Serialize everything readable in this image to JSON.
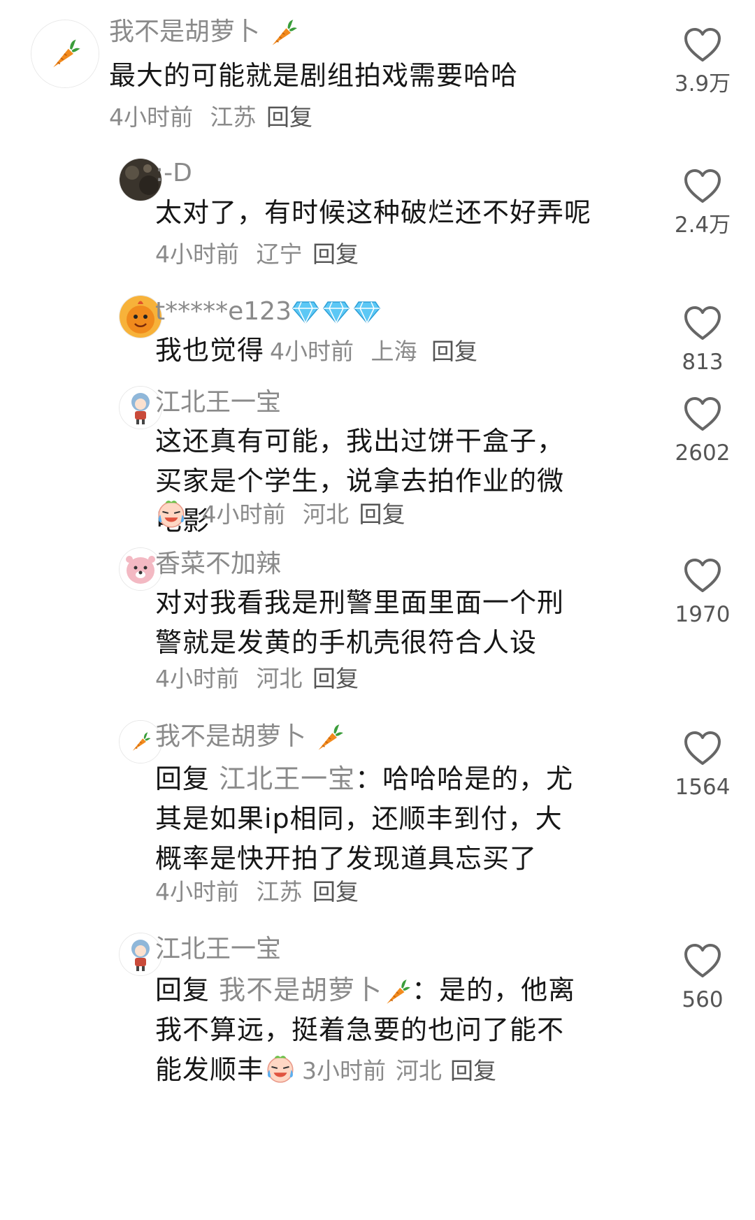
{
  "comments": [
    {
      "username": "我不是胡萝卜",
      "text": "最大的可能就是剧组拍戏需要哈哈",
      "time": "4小时前",
      "location": "江苏",
      "reply_label": "回复",
      "likes": "3.9万",
      "avatar_icon": "carrot-icon"
    },
    {
      "username": ":-D",
      "text": "太对了，有时候这种破烂还不好弄呢",
      "time": "4小时前",
      "location": "辽宁",
      "reply_label": "回复",
      "likes": "2.4万",
      "avatar_icon": "dark-photo-avatar"
    },
    {
      "username": "t*****e123",
      "text": "我也觉得",
      "time": "4小时前",
      "location": "上海",
      "reply_label": "回复",
      "likes": "813",
      "avatar_icon": "orange-cartoon-avatar",
      "badges": [
        "diamond-icon",
        "diamond-icon",
        "diamond-icon"
      ]
    },
    {
      "username": "江北王一宝",
      "text": "这还真有可能，我出过饼干盒子，买家是个学生，说拿去拍作业的微电影",
      "time": "4小时前",
      "location": "河北",
      "reply_label": "回复",
      "likes": "2602",
      "avatar_icon": "chibi-avatar",
      "emoji": "crying-laugh-emoji"
    },
    {
      "username": "香菜不加辣",
      "text": "对对我看我是刑警里面里面一个刑警就是发黄的手机壳很符合人设",
      "time": "4小时前",
      "location": "河北",
      "reply_label": "回复",
      "likes": "1970",
      "avatar_icon": "pink-beaver-avatar"
    },
    {
      "username": "我不是胡萝卜",
      "reply_prefix": "回复",
      "mention": "江北王一宝",
      "text": "：哈哈哈是的，尤其是如果ip相同，还顺丰到付，大概率是快开拍了发现道具忘买了",
      "time": "4小时前",
      "location": "江苏",
      "reply_label": "回复",
      "likes": "1564",
      "avatar_icon": "carrot-icon"
    },
    {
      "username": "江北王一宝",
      "reply_prefix": "回复",
      "mention": "我不是胡萝卜",
      "text": "：是的，他离我不算远，挺着急要的也问了能不能发顺丰",
      "time": "3小时前",
      "location": "河北",
      "reply_label": "回复",
      "likes": "560",
      "avatar_icon": "chibi-avatar",
      "emoji": "crying-laugh-emoji"
    }
  ],
  "colors": {
    "text": "#161616",
    "secondary": "#8a8a8a",
    "heart_outline": "#666666",
    "carrot": "#f28a1d",
    "diamond": "#5cc8f5"
  }
}
